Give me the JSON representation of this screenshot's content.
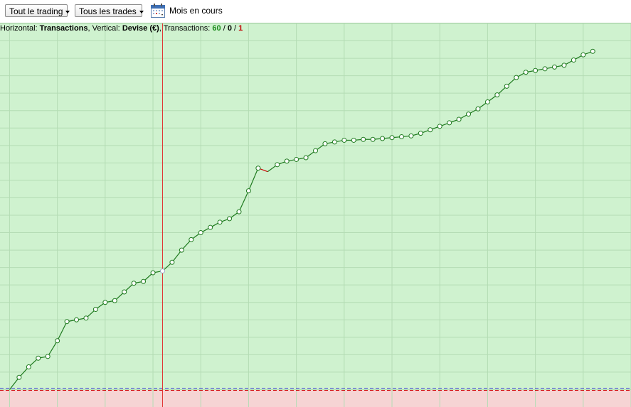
{
  "toolbar": {
    "trading_select": "Tout le trading",
    "trades_select": "Tous les trades",
    "period_label": "Mois en cours",
    "calendar_icon": "calendar-icon"
  },
  "caption": {
    "horizontal_label": "Horizontal:",
    "horizontal_value": "Transactions",
    "vertical_label": ", Vertical:",
    "vertical_value": "Devise (€)",
    "transactions_label": ", Transactions:",
    "wins": "60",
    "sep1": " / ",
    "neutral": "0",
    "sep2": " / ",
    "losses": "1"
  },
  "colors": {
    "positive_bg": "#cff2cf",
    "negative_bg": "#f6d4d4",
    "grid": "#b4dcb4",
    "line_gain": "#1e7a1e",
    "line_loss": "#cc0000",
    "cursor": "#e03030",
    "zero_line": "#4040d0"
  },
  "chart_data": {
    "type": "line",
    "xlabel": "Transactions",
    "ylabel": "Devise (€)",
    "x": [
      0,
      1,
      2,
      3,
      4,
      5,
      6,
      7,
      8,
      9,
      10,
      11,
      12,
      13,
      14,
      15,
      16,
      17,
      18,
      19,
      20,
      21,
      22,
      23,
      24,
      25,
      26,
      27,
      28,
      29,
      30,
      31,
      32,
      33,
      34,
      35,
      36,
      37,
      38,
      39,
      40,
      41,
      42,
      43,
      44,
      45,
      46,
      47,
      48,
      49,
      50,
      51,
      52,
      53,
      54,
      55,
      56,
      57,
      58,
      59,
      60,
      61
    ],
    "values": [
      0.0,
      0.7,
      1.3,
      1.8,
      1.9,
      2.8,
      3.9,
      4.0,
      4.1,
      4.6,
      5.0,
      5.1,
      5.6,
      6.1,
      6.2,
      6.7,
      6.8,
      7.3,
      8.0,
      8.6,
      9.0,
      9.3,
      9.6,
      9.8,
      10.2,
      11.4,
      12.7,
      12.5,
      12.9,
      13.1,
      13.2,
      13.3,
      13.7,
      14.1,
      14.2,
      14.3,
      14.3,
      14.35,
      14.35,
      14.4,
      14.45,
      14.5,
      14.55,
      14.7,
      14.9,
      15.1,
      15.3,
      15.5,
      15.8,
      16.1,
      16.5,
      16.9,
      17.4,
      17.9,
      18.2,
      18.3,
      18.4,
      18.5,
      18.6,
      18.9,
      19.2,
      19.4
    ],
    "losing_transactions": [
      27
    ],
    "highlighted_x": 16,
    "xlim": [
      -1,
      65
    ],
    "ylim": [
      -1,
      21
    ],
    "grid": true,
    "legend": "none"
  }
}
